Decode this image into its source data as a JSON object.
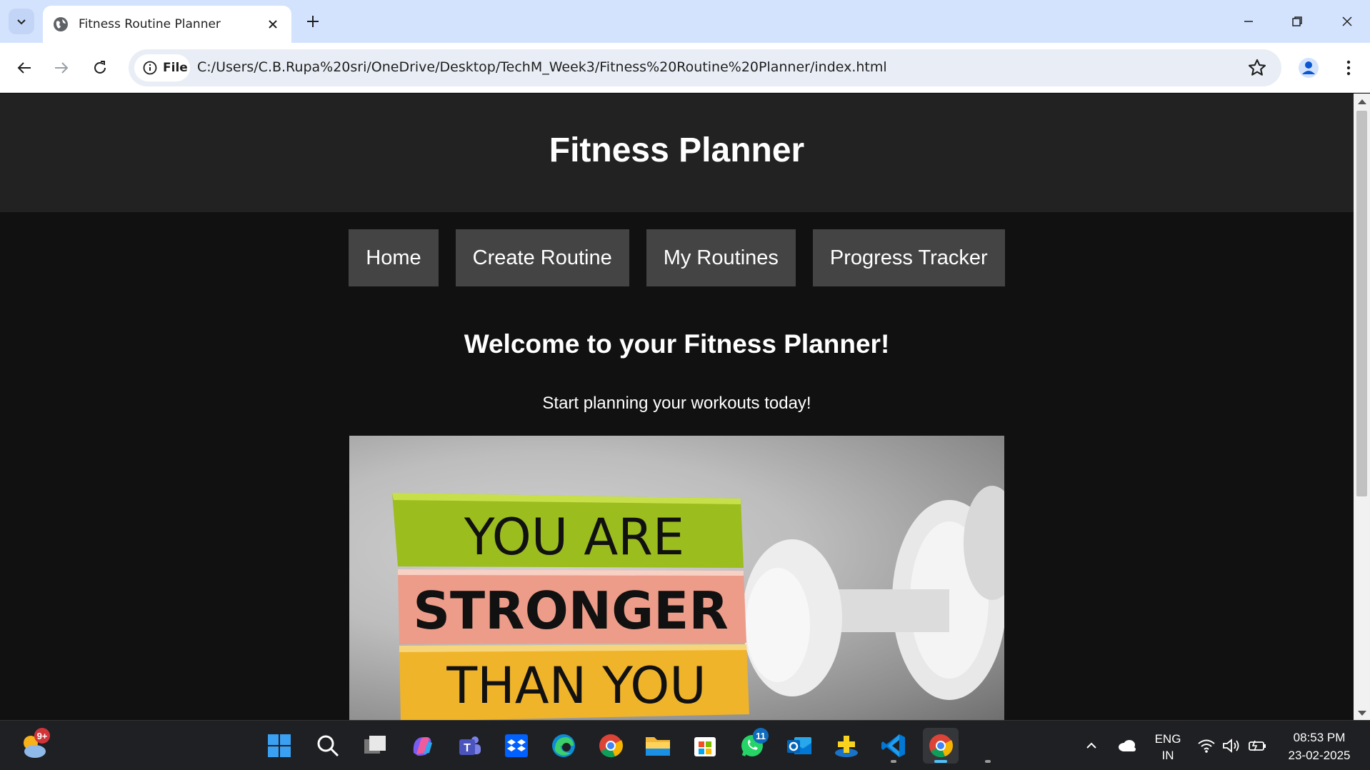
{
  "browser": {
    "tab_title": "Fitness Routine Planner",
    "address_chip": "File",
    "url": "C:/Users/C.B.Rupa%20sri/OneDrive/Desktop/TechM_Week3/Fitness%20Routine%20Planner/index.html"
  },
  "page": {
    "header_title": "Fitness Planner",
    "nav": [
      "Home",
      "Create Routine",
      "My Routines",
      "Progress Tracker"
    ],
    "welcome_heading": "Welcome to your Fitness Planner!",
    "tagline": "Start planning your workouts today!",
    "hero_text": [
      "YOU ARE",
      "STRONGER",
      "THAN YOU"
    ]
  },
  "taskbar": {
    "weather_badge": "9+",
    "whatsapp_badge": "11",
    "language": "ENG",
    "region": "IN",
    "time": "08:53 PM",
    "date": "23-02-2025"
  }
}
